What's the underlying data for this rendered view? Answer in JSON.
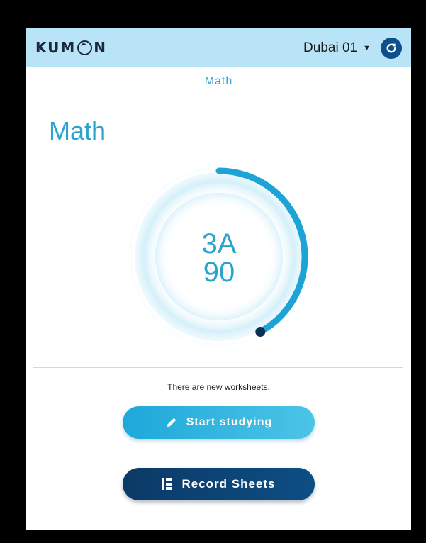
{
  "header": {
    "logo_text_left": "KUM",
    "logo_text_right": "N",
    "center_name": "Dubai 01",
    "center_caret": "▼",
    "refresh_icon": "refresh-icon",
    "background_color": "#b9e3f6"
  },
  "subject_tab": "Math",
  "subject_title": "Math",
  "progress": {
    "level": "3A",
    "worksheet": "90",
    "fraction_complete": 0.42,
    "arc_color": "#1ea3d6",
    "knob_color": "#0b2f55"
  },
  "notice": {
    "text": "There are new worksheets."
  },
  "buttons": {
    "start_label": "Start studying",
    "start_icon": "pencil-icon",
    "record_label": "Record Sheets",
    "record_icon": "record-sheets-icon"
  },
  "colors": {
    "accent": "#2aa4cf",
    "start_button": "#1ea8da",
    "record_button": "#0c3a66"
  }
}
